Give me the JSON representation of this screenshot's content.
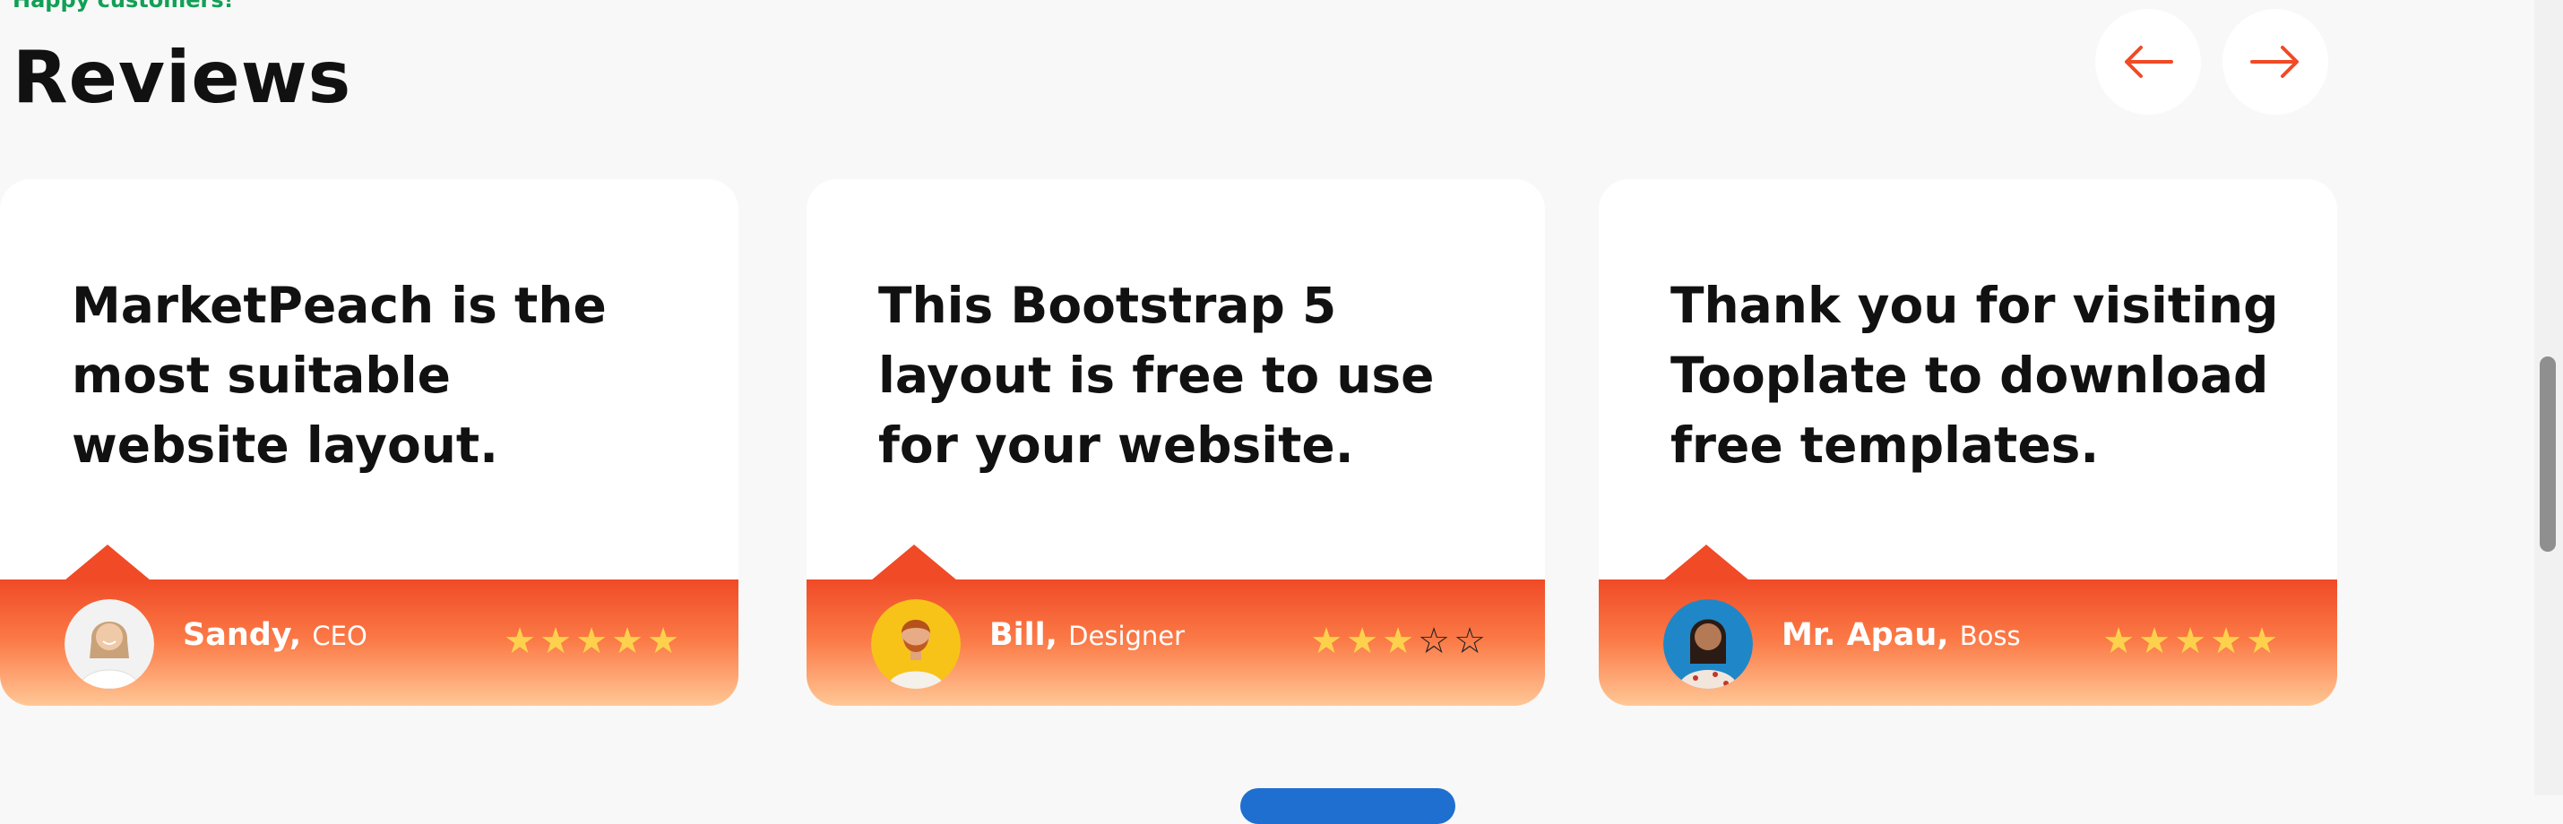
{
  "section": {
    "kicker": "Happy customers!",
    "title": "Reviews"
  },
  "colors": {
    "accent": "#f04a26",
    "star_filled": "#fed14c",
    "kicker_green": "#11a055"
  },
  "nav": {
    "prev_icon": "arrow-left-icon",
    "next_icon": "arrow-right-icon"
  },
  "reviews": [
    {
      "quote": "This Bootstrap 5 layout is free to use for your website.",
      "name": "Bill",
      "separator": ", ",
      "role": "Designer",
      "rating": 3,
      "max_rating": 5,
      "avatar_icon": "bearded-man-avatar"
    },
    {
      "quote": "Thank you for visiting Tooplate to download free templates.",
      "name": "Mr. Apau",
      "separator": ", ",
      "role": "Boss",
      "rating": 5,
      "max_rating": 5,
      "avatar_icon": "woman-avatar"
    },
    {
      "quote": "MarketPeach is the most suitable website layout.",
      "name": "Sandy",
      "separator": ", ",
      "role": "CEO",
      "rating": 5,
      "max_rating": 5,
      "avatar_icon": "smiling-woman-avatar"
    }
  ]
}
